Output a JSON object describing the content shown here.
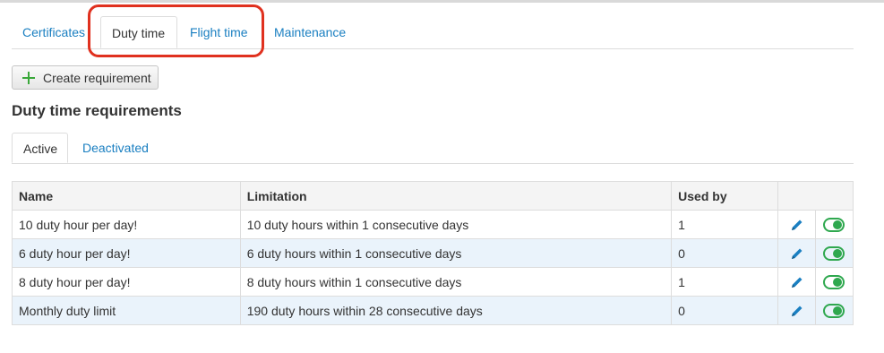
{
  "main_tabs": [
    {
      "label": "Certificates",
      "active": false
    },
    {
      "label": "Duty time",
      "active": true
    },
    {
      "label": "Flight time",
      "active": false
    },
    {
      "label": "Maintenance",
      "active": false
    }
  ],
  "create_button": {
    "label": "Create requirement",
    "icon": "plus-icon"
  },
  "section_title": "Duty time requirements",
  "sub_tabs": [
    {
      "label": "Active",
      "active": true
    },
    {
      "label": "Deactivated",
      "active": false
    }
  ],
  "table": {
    "headers": [
      "Name",
      "Limitation",
      "Used by",
      ""
    ],
    "rows": [
      {
        "name": "10 duty hour per day!",
        "limitation": "10 duty hours within 1 consecutive days",
        "used_by": "1"
      },
      {
        "name": "6 duty hour per day!",
        "limitation": "6 duty hours within 1 consecutive days",
        "used_by": "0"
      },
      {
        "name": "8 duty hour per day!",
        "limitation": "8 duty hours within 1 consecutive days",
        "used_by": "1"
      },
      {
        "name": "Monthly duty limit",
        "limitation": "190 duty hours within 28 consecutive days",
        "used_by": "0"
      }
    ]
  },
  "colors": {
    "link": "#1a7fc1",
    "highlight": "#e0311f",
    "toggle": "#2fa84f",
    "row_alt": "#eaf3fb"
  }
}
